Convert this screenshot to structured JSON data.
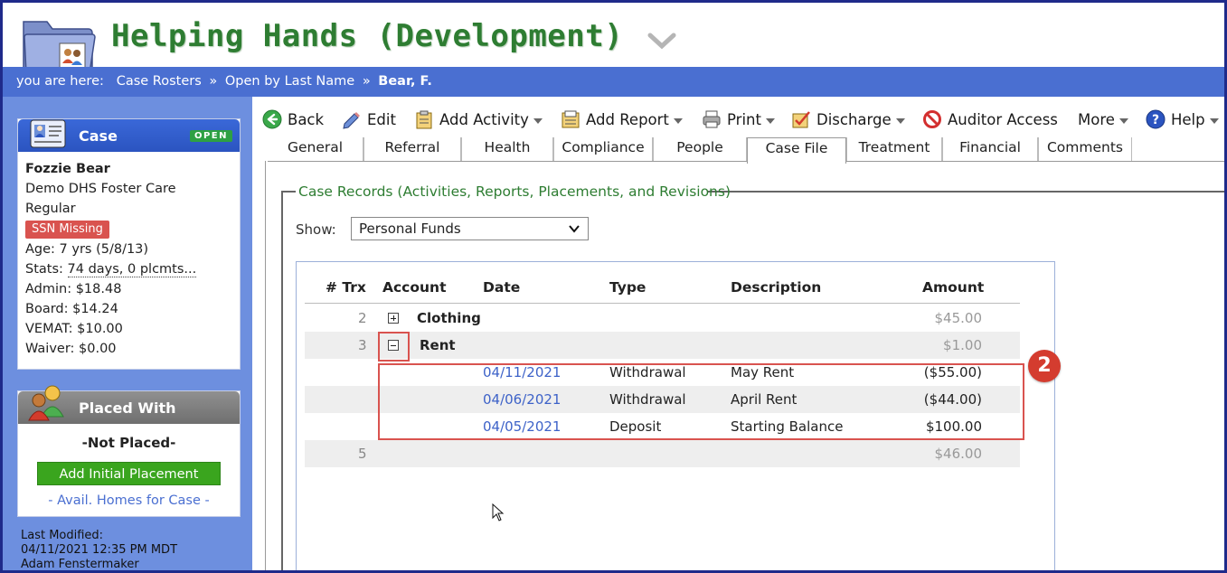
{
  "app": {
    "title": "Helping Hands (Development)"
  },
  "breadcrumb": {
    "prefix": "you are here:",
    "items": [
      "Case Rosters",
      "Open by Last Name"
    ],
    "current": "Bear, F.",
    "separator": "»"
  },
  "sidebar": {
    "case_panel": {
      "title": "Case",
      "status": "OPEN",
      "client_name": "Fozzie Bear",
      "program": "Demo DHS Foster Care",
      "level": "Regular",
      "ssn_badge": "SSN Missing",
      "age": "Age: 7 yrs (5/8/13)",
      "stats_label": "Stats:",
      "stats_value": "74 days, 0 plcmts...",
      "admin": "Admin: $18.48",
      "board": "Board: $14.24",
      "vemat": "VEMAT: $10.00",
      "waiver": "Waiver: $0.00"
    },
    "placed_panel": {
      "title": "Placed With",
      "status_text": "-Not Placed-",
      "add_button": "Add Initial Placement",
      "avail_link": "- Avail. Homes for Case -"
    },
    "last_modified": {
      "label": "Last Modified:",
      "timestamp": "04/11/2021 12:35 PM MDT",
      "user": "Adam Fenstermaker"
    }
  },
  "toolbar": {
    "back": "Back",
    "edit": "Edit",
    "add_activity": "Add Activity",
    "add_report": "Add Report",
    "print": "Print",
    "discharge": "Discharge",
    "auditor_access": "Auditor Access",
    "more": "More",
    "help": "Help"
  },
  "tabs": [
    {
      "label": "General"
    },
    {
      "label": "Referral"
    },
    {
      "label": "Health"
    },
    {
      "label": "Compliance"
    },
    {
      "label": "People"
    },
    {
      "label": "Case File"
    },
    {
      "label": "Treatment"
    },
    {
      "label": "Financial"
    },
    {
      "label": "Comments"
    }
  ],
  "active_tab": "Case File",
  "case_records": {
    "legend": "Case Records (Activities, Reports, Placements, and Revisions)",
    "show_label": "Show:",
    "show_value": "Personal Funds",
    "columns": {
      "trx": "# Trx",
      "account": "Account",
      "date": "Date",
      "type": "Type",
      "description": "Description",
      "amount": "Amount"
    },
    "rows": [
      {
        "trx": "2",
        "account": "Clothing",
        "amount": "$45.00"
      },
      {
        "trx": "3",
        "account": "Rent",
        "amount": "$1.00"
      },
      {
        "date": "04/11/2021",
        "type": "Withdrawal",
        "description": "May Rent",
        "amount": "($55.00)"
      },
      {
        "date": "04/06/2021",
        "type": "Withdrawal",
        "description": "April Rent",
        "amount": "($44.00)"
      },
      {
        "date": "04/05/2021",
        "type": "Deposit",
        "description": "Starting Balance",
        "amount": "$100.00"
      },
      {
        "trx": "5",
        "amount": "$46.00"
      }
    ]
  },
  "annotation": {
    "step_number": "2",
    "color": "#d43c2f"
  },
  "colors": {
    "brand_green": "#2e7d32",
    "nav_blue": "#4a6fd1",
    "sidebar_blue": "#6d8fdf",
    "link_blue": "#3d62c8",
    "highlight_red": "#d9534f"
  }
}
